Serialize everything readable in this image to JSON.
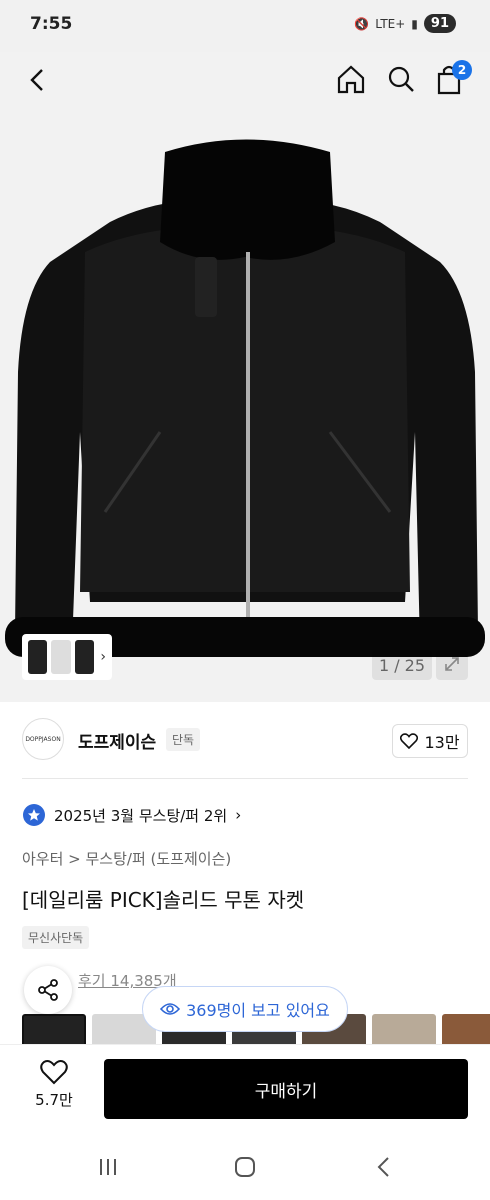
{
  "status": {
    "time": "7:55",
    "network": "LTE+",
    "battery": "91"
  },
  "nav": {
    "cart_count": "2"
  },
  "gallery": {
    "counter": "1 / 25"
  },
  "brand": {
    "logo_text": "DOPPJASON",
    "name": "도프제이슨",
    "tag": "단독",
    "likes": "13만"
  },
  "product": {
    "ranking": "2025년 3월 무스탕/퍼 2위",
    "ranking_chevron": "›",
    "category": "아우터 > 무스탕/퍼 (도프제이슨)",
    "title": "[데일리룸 PICK]솔리드 무톤 자켓",
    "exclusive": "무신사단독",
    "reviews": "후기 14,385개"
  },
  "viewers": "369명이 보고 있어요",
  "bottom": {
    "fav_count": "5.7만",
    "buy_label": "구매하기"
  },
  "colors": {
    "accent_blue": "#1a73e8",
    "viewers_blue": "#2d66d6",
    "buy_bg": "#000000"
  }
}
